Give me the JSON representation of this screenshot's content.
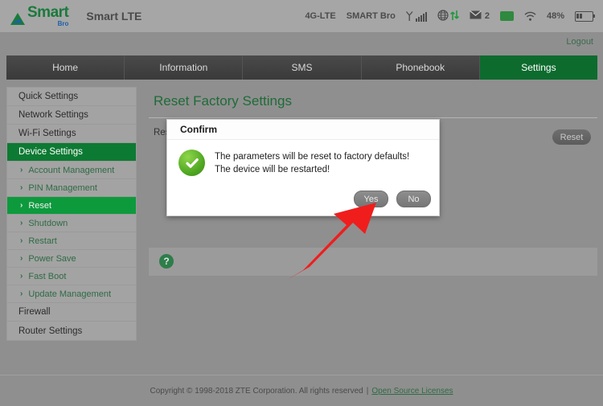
{
  "header": {
    "logo_word": "Smart",
    "logo_sub": "Bro",
    "logo_icon": "smart-triangle-logo-icon",
    "device_name": "Smart LTE",
    "status": {
      "network_type": "4G-LTE",
      "operator": "SMART Bro",
      "signal_icon": "signal-bars-icon",
      "globe_icon": "globe-icon",
      "data_transfer_icon": "up-down-arrows-icon",
      "message_icon": "envelope-icon",
      "message_count": "2",
      "sim_icon": "sim-card-icon",
      "wifi_icon": "wifi-icon",
      "battery_percent": "48%",
      "battery_icon": "battery-icon"
    },
    "logout_label": "Logout"
  },
  "nav": {
    "items": [
      {
        "label": "Home",
        "active": false
      },
      {
        "label": "Information",
        "active": false
      },
      {
        "label": "SMS",
        "active": false
      },
      {
        "label": "Phonebook",
        "active": false
      },
      {
        "label": "Settings",
        "active": true
      }
    ]
  },
  "sidebar": {
    "items": [
      {
        "label": "Quick Settings",
        "type": "item",
        "active": false
      },
      {
        "label": "Network Settings",
        "type": "item",
        "active": false
      },
      {
        "label": "Wi-Fi Settings",
        "type": "item",
        "active": false
      },
      {
        "label": "Device Settings",
        "type": "item",
        "active": true
      },
      {
        "label": "Account Management",
        "type": "sub",
        "active": false
      },
      {
        "label": "PIN Management",
        "type": "sub",
        "active": false
      },
      {
        "label": "Reset",
        "type": "sub",
        "active": true
      },
      {
        "label": "Shutdown",
        "type": "sub",
        "active": false
      },
      {
        "label": "Restart",
        "type": "sub",
        "active": false
      },
      {
        "label": "Power Save",
        "type": "sub",
        "active": false
      },
      {
        "label": "Fast Boot",
        "type": "sub",
        "active": false
      },
      {
        "label": "Update Management",
        "type": "sub",
        "active": false
      },
      {
        "label": "Firewall",
        "type": "item",
        "active": false
      },
      {
        "label": "Router Settings",
        "type": "item",
        "active": false
      }
    ],
    "chevron_glyph": "›"
  },
  "content": {
    "page_title": "Reset Factory Settings",
    "reset_label": "Rese",
    "reset_button": "Reset",
    "help_icon_glyph": "?"
  },
  "dialog": {
    "title": "Confirm",
    "status_icon": "green-check-circle-icon",
    "message_line1": "The parameters will be reset to factory defaults!",
    "message_line2": "The device will be restarted!",
    "yes_label": "Yes",
    "no_label": "No"
  },
  "annotation": {
    "arrow_icon": "red-arrow-pointing-to-yes-button",
    "arrow_color": "#f01d1d"
  },
  "footer": {
    "copyright": "Copyright © 1998-2018 ZTE Corporation. All rights reserved",
    "separator": "|",
    "link_label": "Open Source Licenses"
  },
  "colors": {
    "brand_green": "#0d7a33",
    "nav_active": "#0d6b2e",
    "accent_green": "#1f6b38",
    "page_bg": "#8f8f8f",
    "arrow_red": "#f01d1d"
  }
}
